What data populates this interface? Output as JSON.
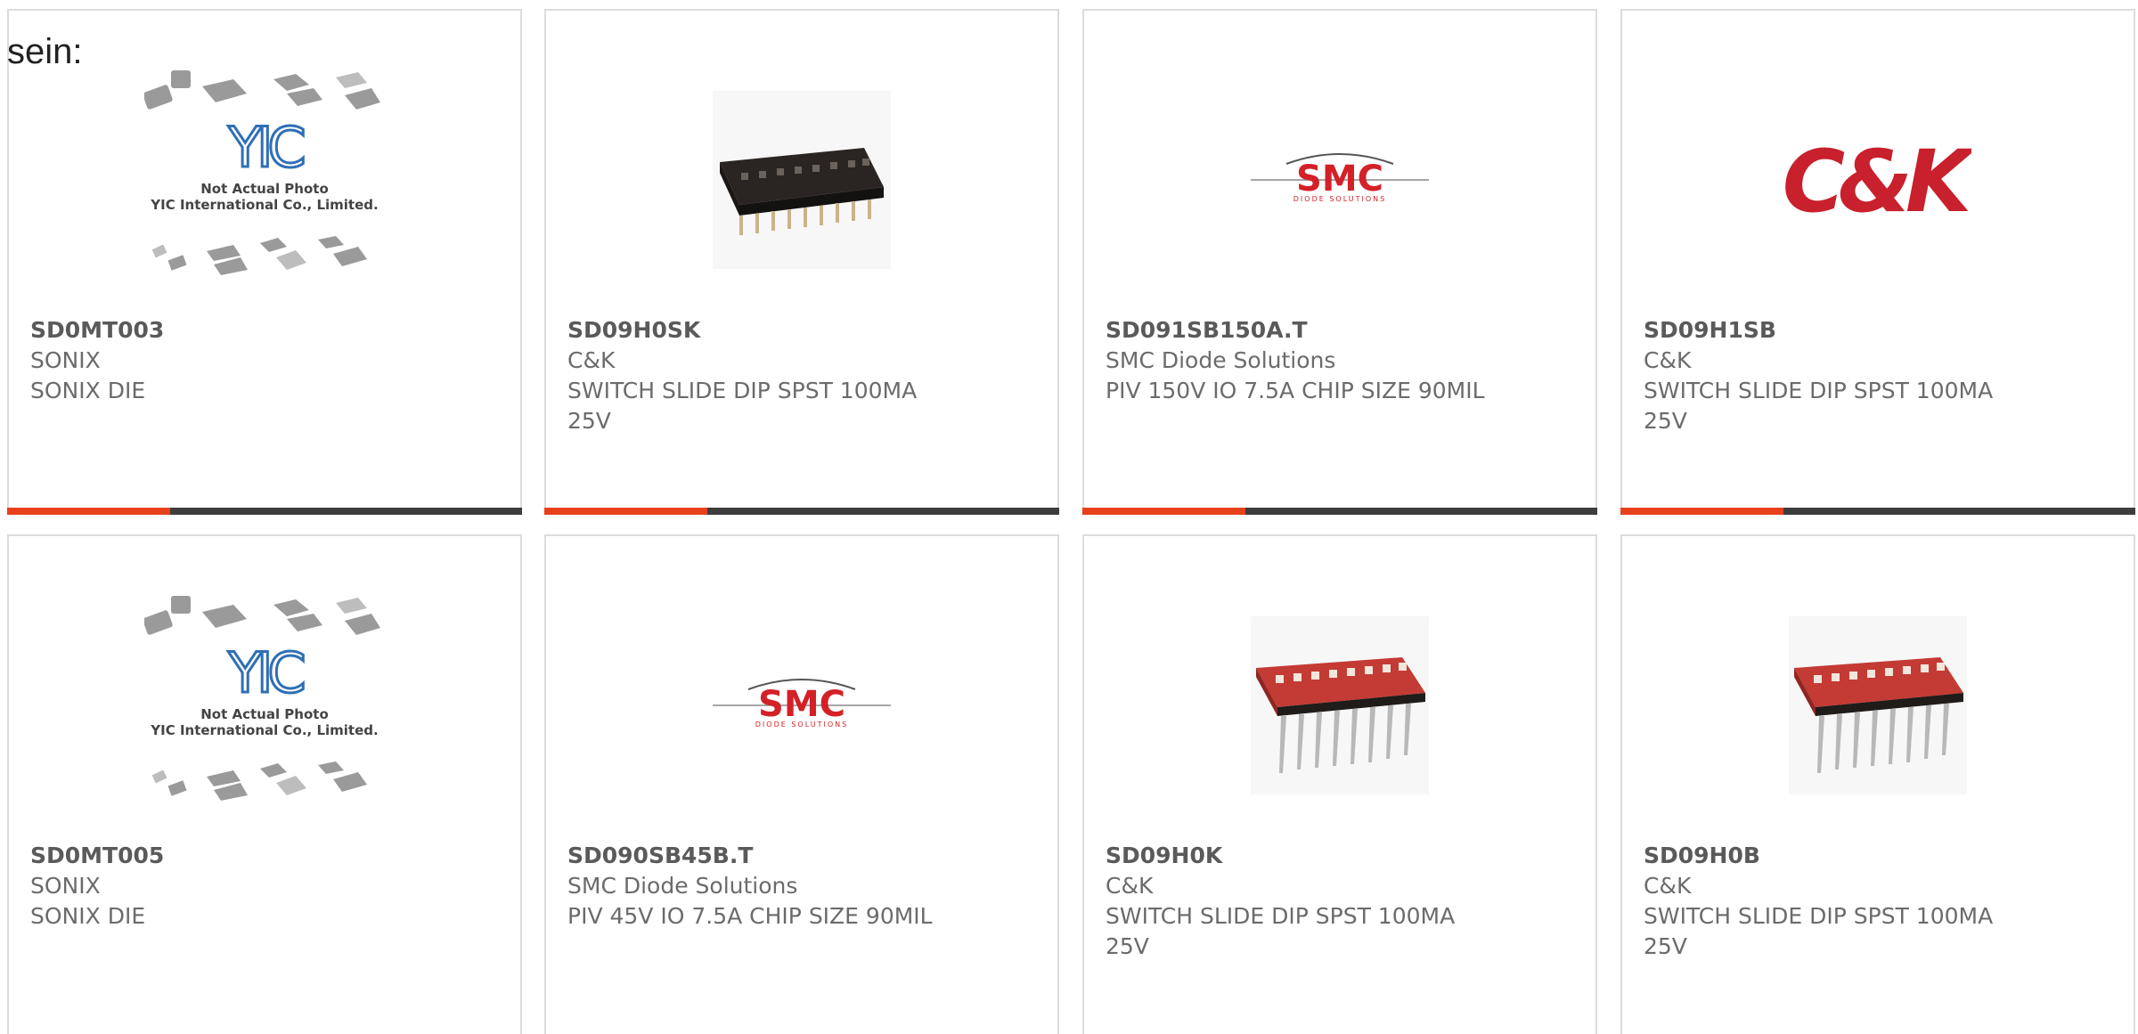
{
  "intro_text": "sein:",
  "placeholder": {
    "logo": "YIC",
    "line1": "Not Actual Photo",
    "line2": "YIC International Co., Limited."
  },
  "brand_logos": {
    "smc": "SMC",
    "smc_sub": "DIODE SOLUTIONS",
    "ck": "C&K"
  },
  "colors": {
    "accent": "#e8401c",
    "bar": "#3d3d3d",
    "smc_red": "#d42027",
    "ck_red": "#c8202c",
    "yic_blue": "#2f6fb5",
    "dip_red": "#c43a34",
    "dip_black": "#1f1c1a"
  },
  "products": [
    {
      "part": "SD0MT003",
      "manufacturer": "SONIX",
      "description": "SONIX DIE",
      "image": "yic-placeholder"
    },
    {
      "part": "SD09H0SK",
      "manufacturer": "C&K",
      "description": "SWITCH SLIDE DIP SPST 100MA 25V",
      "image": "black-smd-dip-switch"
    },
    {
      "part": "SD091SB150A.T",
      "manufacturer": "SMC Diode Solutions",
      "description": "PIV 150V IO 7.5A CHIP SIZE 90MIL",
      "image": "smc-logo"
    },
    {
      "part": "SD09H1SB",
      "manufacturer": "C&K",
      "description": "SWITCH SLIDE DIP SPST 100MA 25V",
      "image": "ck-logo"
    },
    {
      "part": "SD0MT005",
      "manufacturer": "SONIX",
      "description": "SONIX DIE",
      "image": "yic-placeholder"
    },
    {
      "part": "SD090SB45B.T",
      "manufacturer": "SMC Diode Solutions",
      "description": "PIV 45V IO 7.5A CHIP SIZE 90MIL",
      "image": "smc-logo"
    },
    {
      "part": "SD09H0K",
      "manufacturer": "C&K",
      "description": "SWITCH SLIDE DIP SPST 100MA 25V",
      "image": "red-dip-switch"
    },
    {
      "part": "SD09H0B",
      "manufacturer": "C&K",
      "description": "SWITCH SLIDE DIP SPST 100MA 25V",
      "image": "red-dip-switch"
    }
  ]
}
